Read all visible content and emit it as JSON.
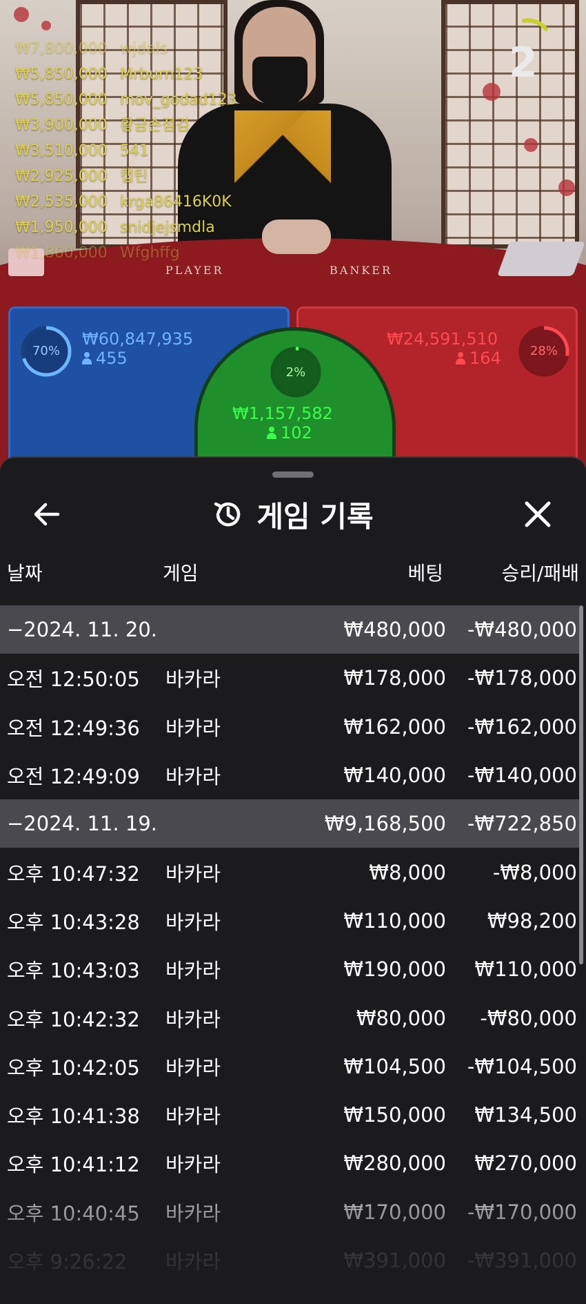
{
  "leaderboard": [
    {
      "amount": "₩7,800,000",
      "name": "wjdals"
    },
    {
      "amount": "₩5,850,000",
      "name": "Mrburn123"
    },
    {
      "amount": "₩5,850,000",
      "name": "mov_godad123"
    },
    {
      "amount": "₩3,900,000",
      "name": "황금손점검"
    },
    {
      "amount": "₩3,510,000",
      "name": "541"
    },
    {
      "amount": "₩2,925,000",
      "name": "캡틴"
    },
    {
      "amount": "₩2,535,000",
      "name": "krga86416K0K"
    },
    {
      "amount": "₩1,950,000",
      "name": "snidjejsmdla"
    },
    {
      "amount": "₩1,860,000",
      "name": "Wfghffg"
    }
  ],
  "countdown": "2",
  "table": {
    "player_word": "PLAYER",
    "banker_word": "BANKER"
  },
  "bets": {
    "player": {
      "percent": "70%",
      "amount": "₩60,847,935",
      "players": "455",
      "color": "#1e50a4"
    },
    "tie": {
      "percent": "2%",
      "amount": "₩1,157,582",
      "players": "102",
      "color": "#1f8f2c"
    },
    "banker": {
      "percent": "28%",
      "amount": "₩24,591,510",
      "players": "164",
      "color": "#b2232a"
    }
  },
  "history": {
    "title": "게임 기록",
    "icons": {
      "back": "arrow-left-icon",
      "history": "history-clock-icon",
      "close": "close-icon"
    },
    "columns": {
      "date": "날짜",
      "game": "게임",
      "bet": "베팅",
      "win_loss": "승리/패배"
    },
    "rows": [
      {
        "type": "group",
        "date": "−2024. 11. 20.",
        "game": "",
        "bet": "₩480,000",
        "win_loss": "-₩480,000"
      },
      {
        "type": "item",
        "date": "오전 12:50:05",
        "game": "바카라",
        "bet": "₩178,000",
        "win_loss": "-₩178,000"
      },
      {
        "type": "item",
        "date": "오전 12:49:36",
        "game": "바카라",
        "bet": "₩162,000",
        "win_loss": "-₩162,000"
      },
      {
        "type": "item",
        "date": "오전 12:49:09",
        "game": "바카라",
        "bet": "₩140,000",
        "win_loss": "-₩140,000"
      },
      {
        "type": "group",
        "date": "−2024. 11. 19.",
        "game": "",
        "bet": "₩9,168,500",
        "win_loss": "-₩722,850"
      },
      {
        "type": "item",
        "date": "오후 10:47:32",
        "game": "바카라",
        "bet": "₩8,000",
        "win_loss": "-₩8,000"
      },
      {
        "type": "item",
        "date": "오후 10:43:28",
        "game": "바카라",
        "bet": "₩110,000",
        "win_loss": "₩98,200"
      },
      {
        "type": "item",
        "date": "오후 10:43:03",
        "game": "바카라",
        "bet": "₩190,000",
        "win_loss": "₩110,000"
      },
      {
        "type": "item",
        "date": "오후 10:42:32",
        "game": "바카라",
        "bet": "₩80,000",
        "win_loss": "-₩80,000"
      },
      {
        "type": "item",
        "date": "오후 10:42:05",
        "game": "바카라",
        "bet": "₩104,500",
        "win_loss": "-₩104,500"
      },
      {
        "type": "item",
        "date": "오후 10:41:38",
        "game": "바카라",
        "bet": "₩150,000",
        "win_loss": "₩134,500"
      },
      {
        "type": "item",
        "date": "오후 10:41:12",
        "game": "바카라",
        "bet": "₩280,000",
        "win_loss": "₩270,000"
      },
      {
        "type": "item",
        "date": "오후 10:40:45",
        "game": "바카라",
        "bet": "₩170,000",
        "win_loss": "-₩170,000"
      },
      {
        "type": "item",
        "date": "오후 9:26:22",
        "game": "바카라",
        "bet": "₩391,000",
        "win_loss": "-₩391,000"
      }
    ]
  }
}
